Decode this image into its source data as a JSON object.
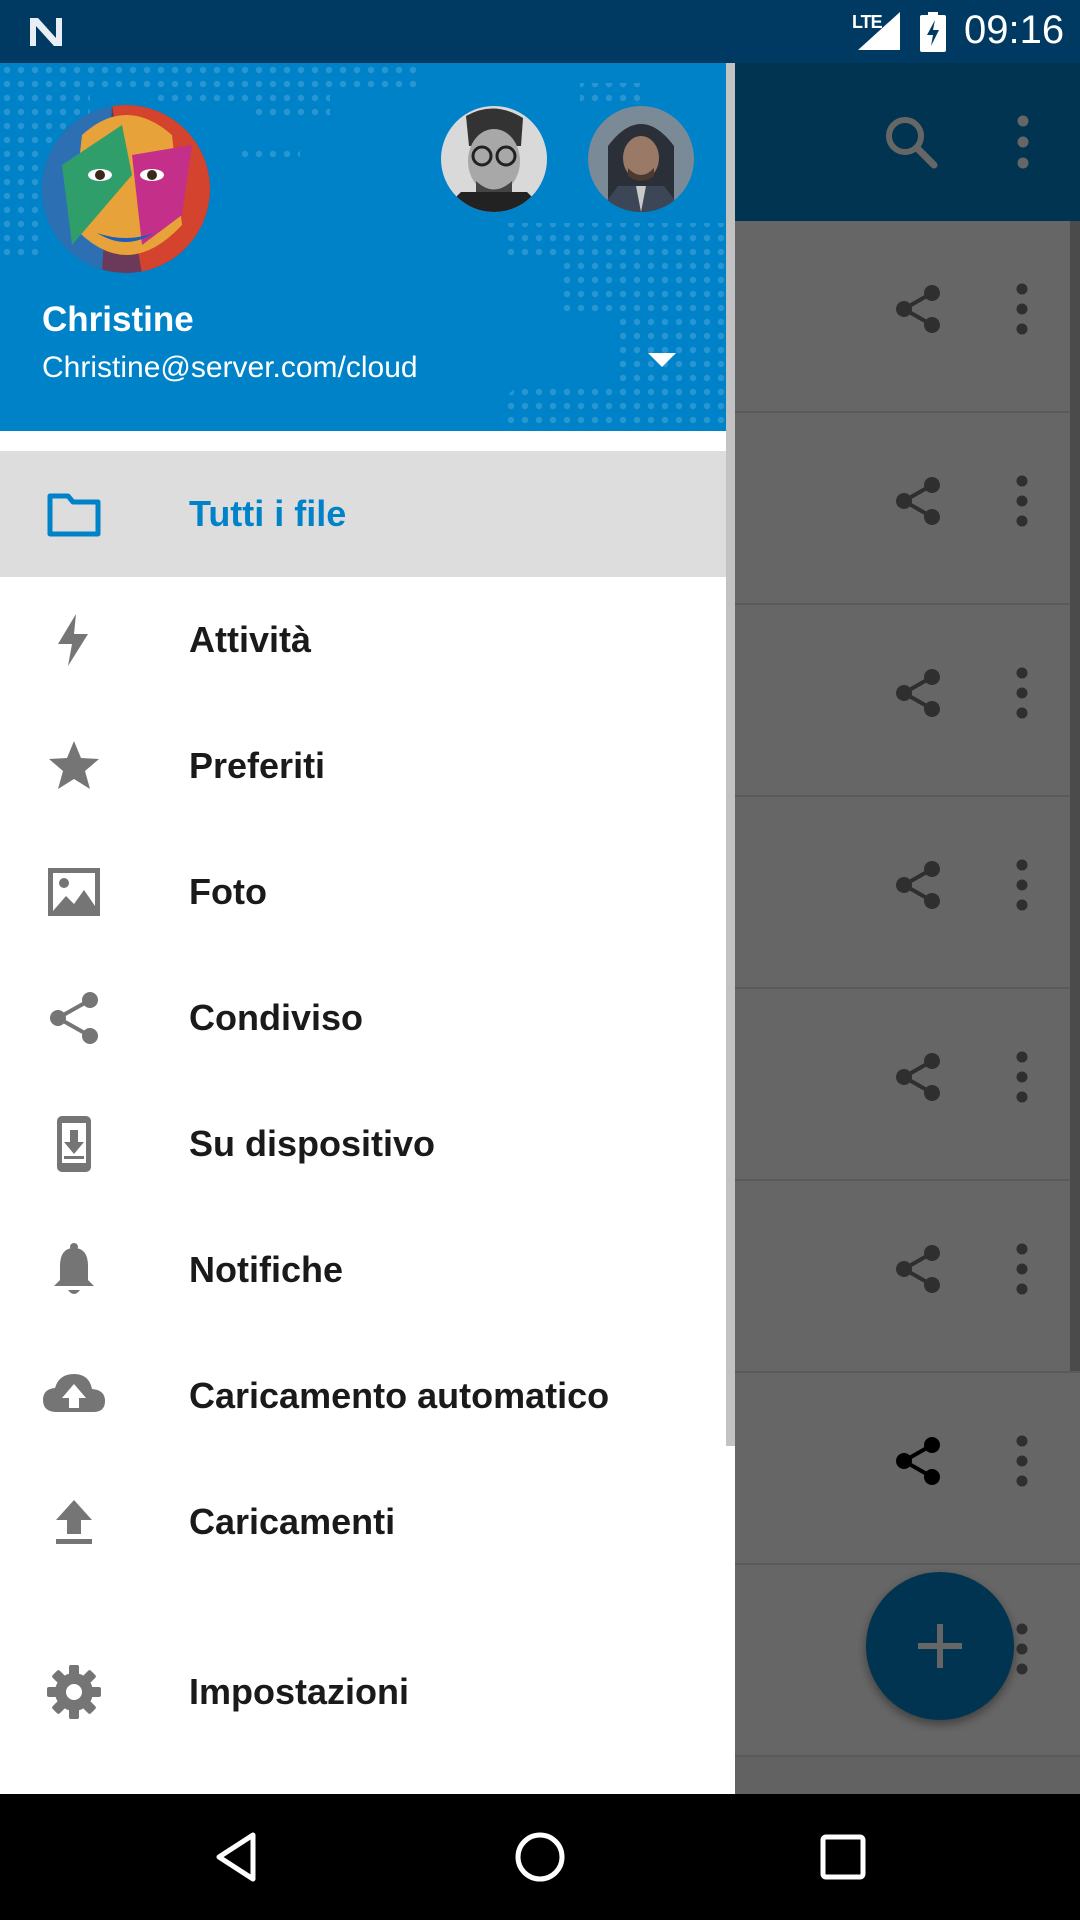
{
  "status_bar": {
    "network": "LTE",
    "time": "09:16"
  },
  "drawer": {
    "account": {
      "name": "Christine",
      "email": "Christine@server.com/cloud"
    },
    "menu": [
      {
        "label": "Tutti i file",
        "icon": "folder-icon",
        "active": true
      },
      {
        "label": "Attività",
        "icon": "bolt-icon"
      },
      {
        "label": "Preferiti",
        "icon": "star-icon"
      },
      {
        "label": "Foto",
        "icon": "image-icon"
      },
      {
        "label": "Condiviso",
        "icon": "share-icon"
      },
      {
        "label": "Su dispositivo",
        "icon": "phone-download-icon"
      },
      {
        "label": "Notifiche",
        "icon": "bell-icon"
      },
      {
        "label": "Caricamento automatico",
        "icon": "cloud-upload-icon"
      },
      {
        "label": "Caricamenti",
        "icon": "upload-icon"
      }
    ],
    "settings": {
      "label": "Impostazioni",
      "icon": "gear-icon"
    }
  },
  "colors": {
    "brand": "#0082c9",
    "status_bar": "#003a63",
    "active_row": "#dddddd"
  }
}
